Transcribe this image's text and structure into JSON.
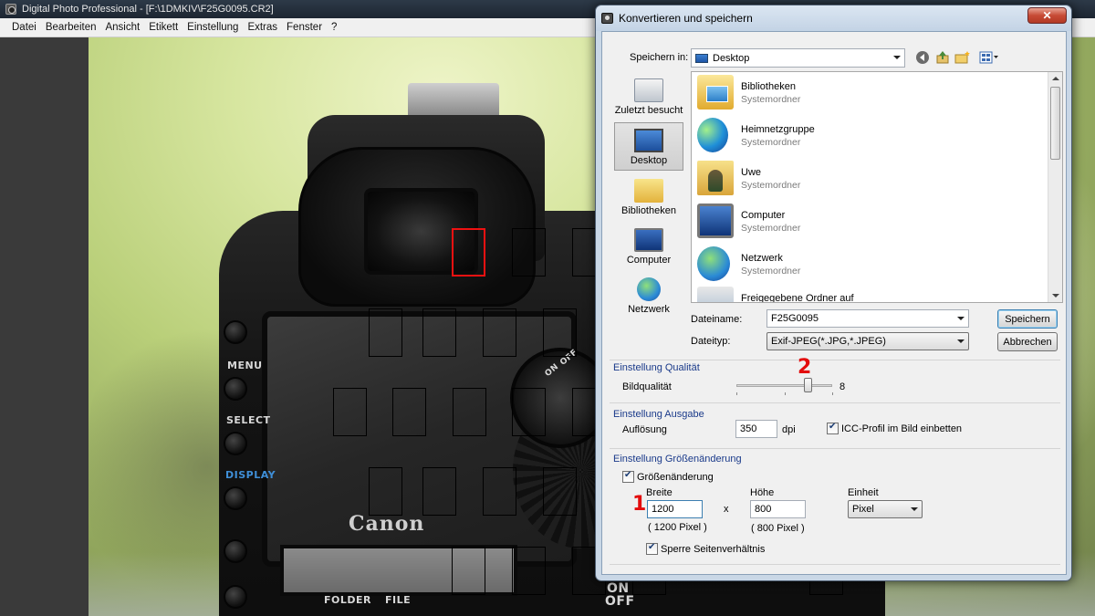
{
  "app": {
    "title": "Digital Photo Professional - [F:\\1DMKIV\\F25G0095.CR2]",
    "ghost_tabs": [
      "",
      ""
    ],
    "menu": [
      "Datei",
      "Bearbeiten",
      "Ansicht",
      "Etikett",
      "Einstellung",
      "Extras",
      "Fenster",
      "?"
    ]
  },
  "camera": {
    "labels": [
      "MENU",
      "SELECT",
      "DISPLAY",
      "ON",
      "OFF",
      "ON",
      "OFF",
      "FOLDER",
      "FILE"
    ],
    "brand": "Canon"
  },
  "dialog": {
    "title": "Konvertieren und speichern",
    "close_glyph": "✕",
    "save_in_label": "Speichern in:",
    "save_in_value": "Desktop",
    "places": [
      "Zuletzt besucht",
      "Desktop",
      "Bibliotheken",
      "Computer",
      "Netzwerk"
    ],
    "files": [
      {
        "name": "Bibliotheken",
        "type": "Systemordner"
      },
      {
        "name": "Heimnetzgruppe",
        "type": "Systemordner"
      },
      {
        "name": "Uwe",
        "type": "Systemordner"
      },
      {
        "name": "Computer",
        "type": "Systemordner"
      },
      {
        "name": "Netzwerk",
        "type": "Systemordner"
      },
      {
        "name": "Freigegebene Ordner auf",
        "type": ""
      }
    ],
    "filename_label": "Dateiname:",
    "filename_value": "F25G0095",
    "filetype_label": "Dateityp:",
    "filetype_value": "Exif-JPEG(*.JPG,*.JPEG)",
    "save_button": "Speichern",
    "cancel_button": "Abbrechen",
    "quality": {
      "group": "Einstellung Qualität",
      "label": "Bildqualität",
      "value": "8",
      "level": 8,
      "max": 10
    },
    "output": {
      "group": "Einstellung Ausgabe",
      "resolution_label": "Auflösung",
      "resolution_value": "350",
      "unit": "dpi",
      "icc_label": "ICC-Profil im Bild einbetten"
    },
    "resize": {
      "group": "Einstellung Größenänderung",
      "check_label": "Größenänderung",
      "width_label": "Breite",
      "width_value": "1200",
      "width_px": "( 1200 Pixel )",
      "x": "x",
      "height_label": "Höhe",
      "height_value": "800",
      "height_px": "( 800 Pixel )",
      "unit_label": "Einheit",
      "unit_value": "Pixel",
      "lock_label": "Sperre Seitenverhältnis"
    }
  },
  "annotations": {
    "one": "1",
    "two": "2"
  }
}
